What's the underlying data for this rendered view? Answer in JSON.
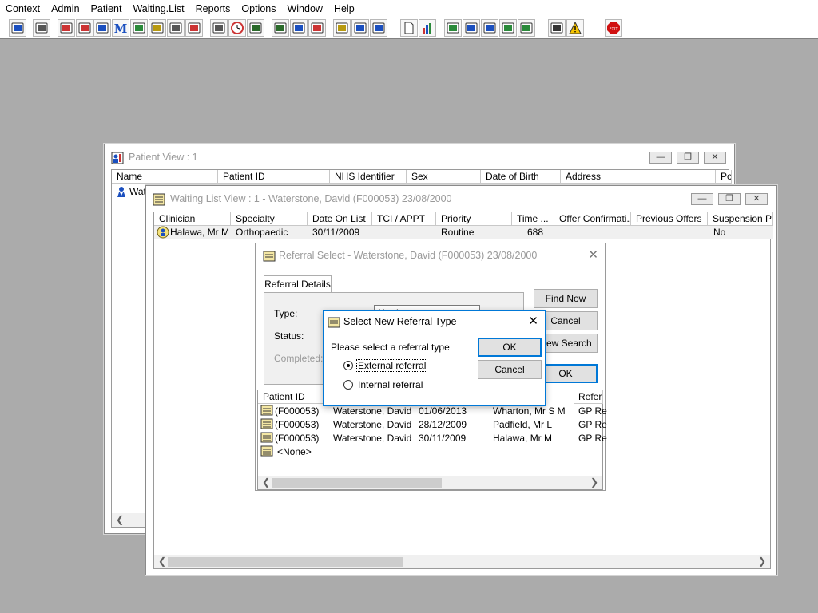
{
  "menu": [
    "Context",
    "Admin",
    "Patient",
    "Waiting.List",
    "Reports",
    "Options",
    "Window",
    "Help"
  ],
  "toolbar_icons": [
    "person-icon",
    "printer-icon",
    "book-icon",
    "edit-icon",
    "list-icon",
    "m-icon",
    "doctor-icon",
    "note-icon",
    "bed-icon",
    "ambulance-icon",
    "search-doc-icon",
    "clock-icon",
    "monitor-icon",
    "calendar-icon",
    "screen-icon",
    "dial-icon",
    "notepad-icon",
    "bed2-icon",
    "user-edit-icon",
    "page-icon",
    "chart-icon",
    "globe-icon",
    "check-doc-icon",
    "check-doc2-icon",
    "green-check-icon",
    "green-check2-icon",
    "transfer-icon",
    "warning-icon",
    "exit-icon"
  ],
  "colors": {
    "desktop": "#ababab",
    "selection": "#0078d7",
    "exit": "#d01010"
  },
  "patient_view": {
    "title": "Patient View : 1",
    "columns": [
      "Name",
      "Patient ID",
      "NHS Identifier",
      "Sex",
      "Date of Birth",
      "Address",
      "Po"
    ],
    "row_name": "Wate"
  },
  "waiting_view": {
    "title": "Waiting List View :  1 - Waterstone, David (F000053) 23/08/2000",
    "columns": [
      "Clinician",
      "Specialty",
      "Date On List",
      "TCI / APPT",
      "Priority",
      "Time ...",
      "Offer Confirmati...",
      "Previous Offers",
      "Suspension Pe"
    ],
    "row": [
      "Halawa, Mr M",
      "Orthopaedic",
      "30/11/2009",
      "",
      "Routine",
      "688",
      "",
      "",
      "No"
    ]
  },
  "referral_select": {
    "title": "Referral Select - Waterstone, David (F000053) 23/08/2000",
    "tab": "Referral Details",
    "type_label": "Type:",
    "status_label": "Status:",
    "completed_label": "Completed:",
    "type_value": "(Any)",
    "find_now": "Find Now",
    "cancel": "Cancel",
    "new_search": "New Search",
    "ok": "OK",
    "list_col_first": "Patient ID",
    "list_col_last": "Referra",
    "rows": [
      {
        "id": "(F000053)",
        "name": "Waterstone, David",
        "date": "01/06/2013",
        "clin": "Wharton, Mr S M",
        "ref": "GP Re"
      },
      {
        "id": "(F000053)",
        "name": "Waterstone, David",
        "date": "28/12/2009",
        "clin": "Padfield, Mr L",
        "ref": "GP Re"
      },
      {
        "id": "(F000053)",
        "name": "Waterstone, David",
        "date": "30/11/2009",
        "clin": "Halawa, Mr M",
        "ref": "GP Re"
      }
    ],
    "none_row": "<None>"
  },
  "new_type_dialog": {
    "title": "Select New Referral Type",
    "prompt": "Please select a referral type",
    "ok": "OK",
    "cancel": "Cancel",
    "option_external": "External referral",
    "option_internal": "Internal referral",
    "selected": "External referral"
  }
}
